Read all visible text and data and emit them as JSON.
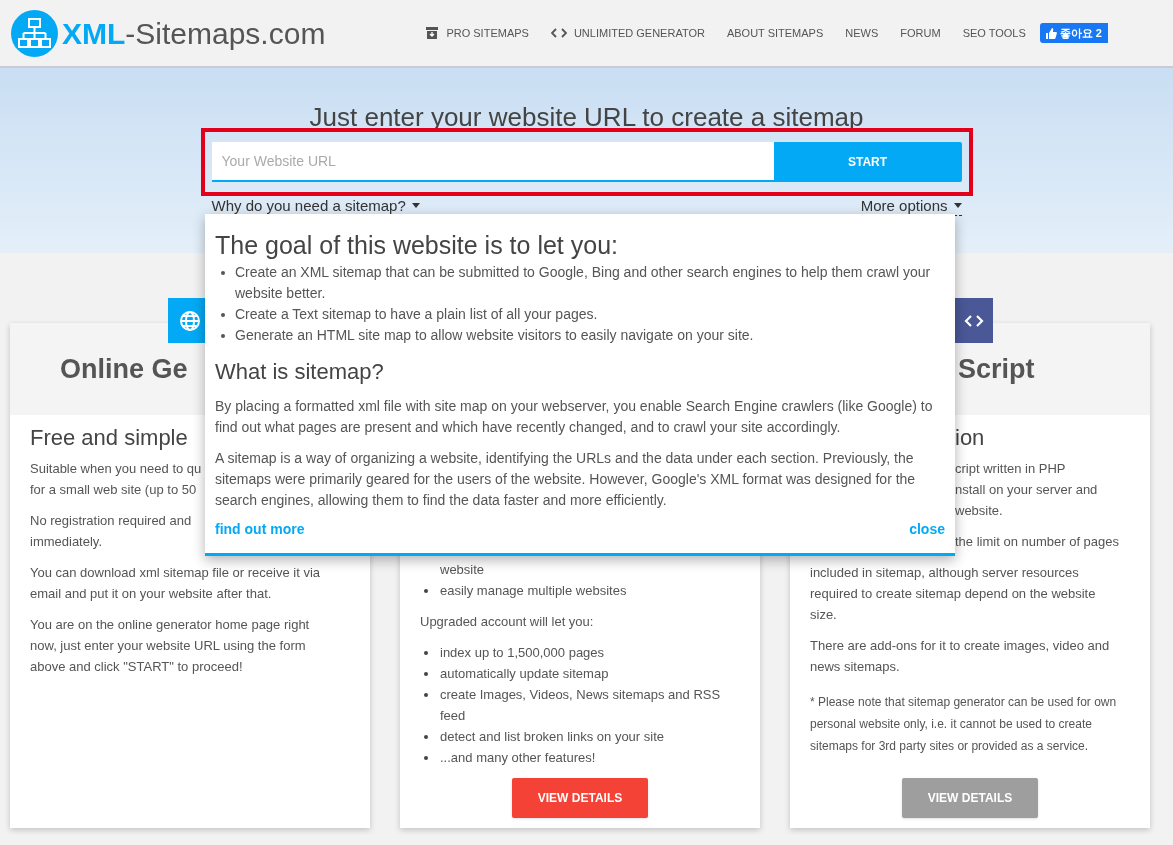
{
  "header": {
    "logo": {
      "bold": "XML",
      "rest": "-Sitemaps.com"
    },
    "nav": [
      {
        "label": "PRO SITEMAPS"
      },
      {
        "label": "UNLIMITED GENERATOR"
      },
      {
        "label": "ABOUT SITEMAPS"
      },
      {
        "label": "NEWS"
      },
      {
        "label": "FORUM"
      },
      {
        "label": "SEO TOOLS"
      }
    ],
    "like_button": "좋아요 2"
  },
  "hero": {
    "title": "Just enter your website URL to create a sitemap",
    "highlighted": true,
    "url_field": {
      "placeholder": "Your Website URL"
    },
    "start_button": "START",
    "why_link": "Why do you need a sitemap?",
    "more_options_link": "More options"
  },
  "popup": {
    "heading": "The goal of this website is to let you:",
    "bullets": [
      "Create an XML sitemap that can be submitted to Google, Bing and other search engines to help them crawl your website better.",
      "Create a Text sitemap to have a plain list of all your pages.",
      "Generate an HTML site map to allow website visitors to easily navigate on your site."
    ],
    "subheading": "What is sitemap?",
    "paragraphs": [
      "By placing a formatted xml file with site map on your webserver, you enable Search Engine crawlers (like Google) to find out what pages are present and which have recently changed, and to crawl your site accordingly.",
      "A sitemap is a way of organizing a website, identifying the URLs and the data under each section. Previously, the sitemaps were primarily geared for the users of the website. However, Google's XML format was designed for the search engines, allowing them to find the data faster and more efficiently."
    ],
    "find_out_more": "find out more",
    "close": "close"
  },
  "cards": [
    {
      "title": "Online Ge",
      "subtitle": "Free and simple",
      "items": [
        {
          "kind": "paragraph",
          "lines": [
            "Suitable when you need to qu",
            "for a small web site (up to 50"
          ]
        },
        {
          "kind": "paragraph",
          "lines": [
            "No registration required and",
            "immediately."
          ]
        },
        {
          "kind": "paragraph",
          "lines": [
            "You can download xml sitemap file or receive it via",
            "email and put it on your website after that."
          ]
        },
        {
          "kind": "paragraph",
          "lines": [
            "You are on the online generator home page right",
            "now, just enter your website URL using the form",
            "above and click \"START\" to proceed!"
          ]
        }
      ]
    },
    {
      "items": [
        {
          "kind": "continuation",
          "lines": [
            "website"
          ]
        },
        {
          "kind": "bullet",
          "lines": [
            "easily manage multiple websites"
          ]
        },
        {
          "kind": "paragraph",
          "lines": [
            "Upgraded account will let you:"
          ]
        },
        {
          "kind": "bullet",
          "lines": [
            "index up to 1,500,000 pages"
          ]
        },
        {
          "kind": "bullet",
          "lines": [
            "automatically update sitemap"
          ]
        },
        {
          "kind": "bullet",
          "lines": [
            "create Images, Videos, News sitemaps and RSS",
            "feed"
          ]
        },
        {
          "kind": "bullet",
          "lines": [
            "detect and list broken links on your site"
          ]
        },
        {
          "kind": "bullet",
          "lines": [
            "...and many other features!"
          ]
        }
      ],
      "button": {
        "label": "VIEW DETAILS",
        "color": "#f44336"
      }
    },
    {
      "title": "Script",
      "subtitle": "ion",
      "items": [
        {
          "kind": "clipped",
          "lines": [
            "cript written in PHP",
            "nstall on your server and",
            "website."
          ]
        },
        {
          "kind": "clipped",
          "lines": [
            "the limit on number of pages"
          ]
        },
        {
          "kind": "paragraph",
          "lines": [
            "included in sitemap, although server resources",
            "required to create sitemap depend on the website",
            "size."
          ]
        },
        {
          "kind": "paragraph",
          "lines": [
            "There are add-ons for it to create images, video and",
            "news sitemaps."
          ]
        },
        {
          "kind": "note",
          "lines": [
            "* Please note that sitemap generator can be used for own",
            "personal website only, i.e. it cannot be used to create",
            "sitemaps for 3rd party sites or provided as a service."
          ]
        }
      ],
      "button": {
        "label": "VIEW DETAILS",
        "color": "#9e9e9e"
      }
    }
  ]
}
